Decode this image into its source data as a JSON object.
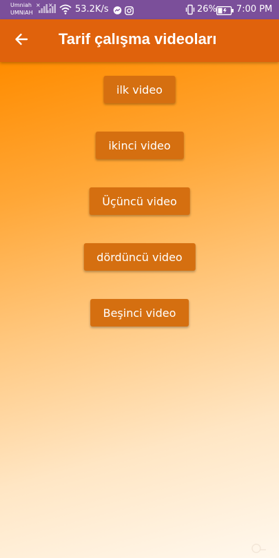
{
  "status_bar": {
    "carrier_top": "Umniah",
    "carrier_bottom": "UMNIAH",
    "x_mark": "×",
    "net_speed": "53.2K/s",
    "battery_percent": "26%",
    "time": "7:00 PM",
    "icons": [
      "signal-icon",
      "wifi-icon",
      "messenger-icon",
      "instagram-icon",
      "vibrate-icon",
      "battery-icon"
    ],
    "background_color": "#7b4f9a"
  },
  "app_bar": {
    "title": "Tarif çalışma videoları",
    "back_icon": "arrow-left-icon",
    "background_color": "#e0620c"
  },
  "videos": [
    {
      "label": "ilk video"
    },
    {
      "label": "ikinci video"
    },
    {
      "label": "Üçüncü video"
    },
    {
      "label": "dördüncü video"
    },
    {
      "label": "Beşinci video"
    }
  ],
  "colors": {
    "button_background": "#d56f10",
    "gradient_top": "#ff8c00",
    "gradient_bottom": "#fff8ee"
  }
}
